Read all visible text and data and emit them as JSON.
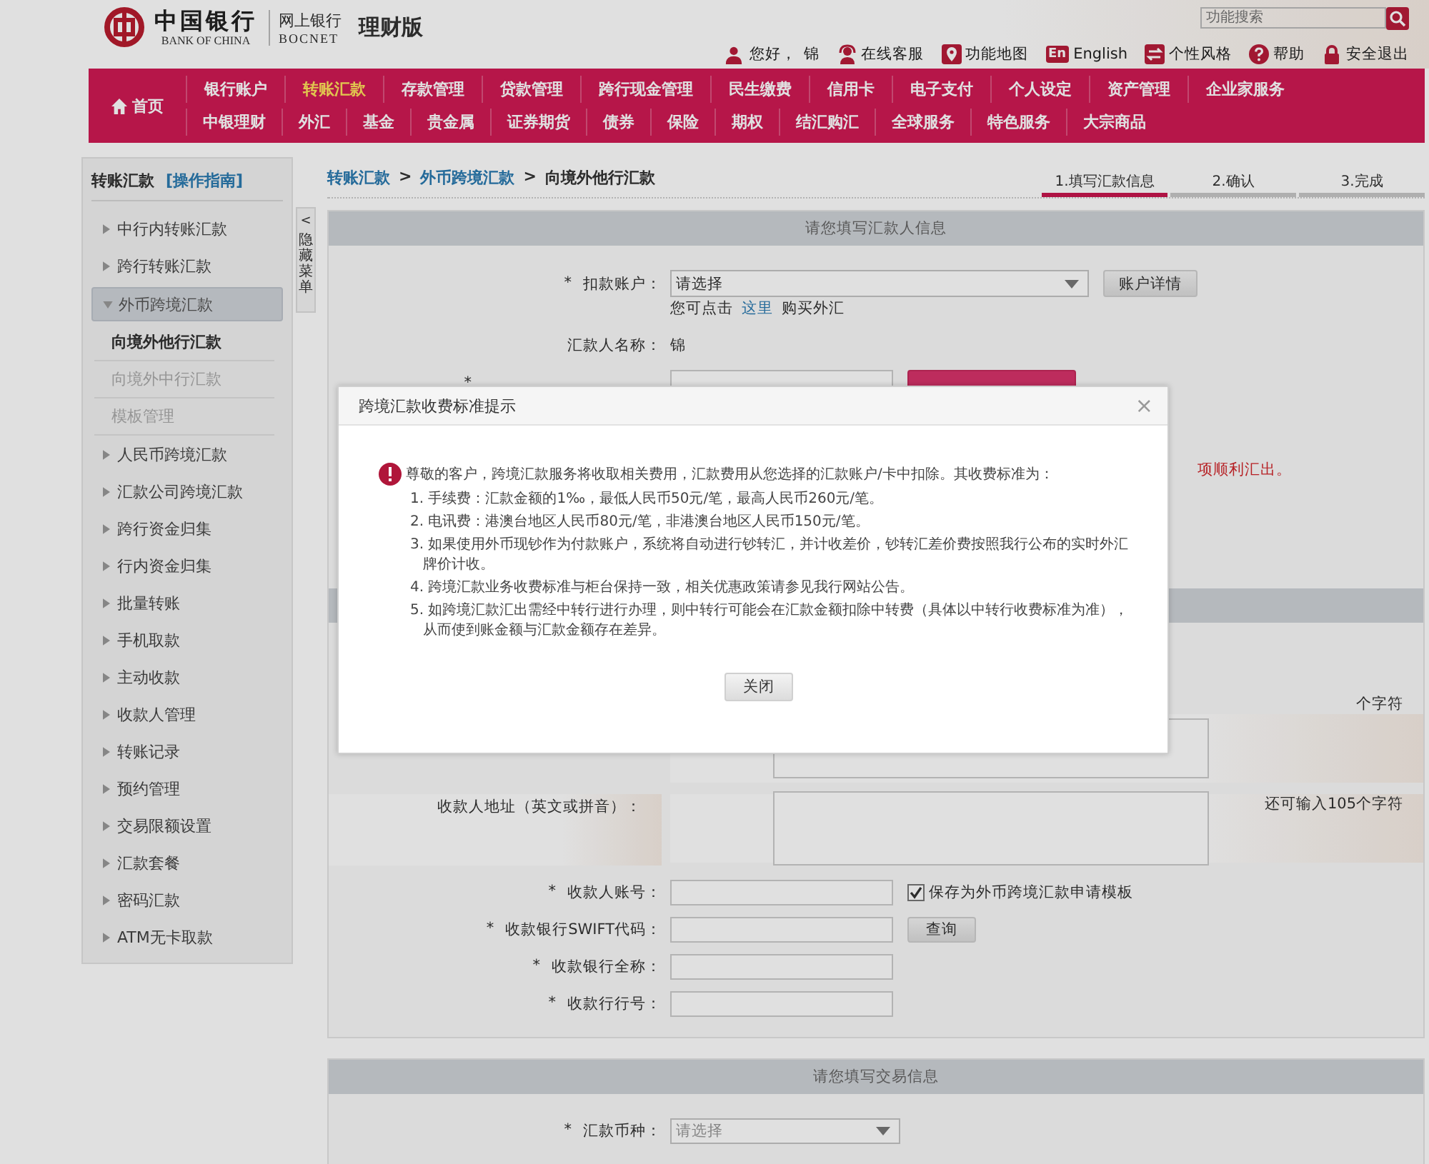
{
  "header": {
    "logo": {
      "name_cn": "中国银行",
      "name_en": "BANK OF CHINA"
    },
    "product": "网上银行",
    "product_en": "BOCNET",
    "edition": "理财版",
    "search": {
      "placeholder": "功能搜索"
    },
    "greeting": "您好，",
    "user_name": "锦",
    "links": [
      {
        "kind": "service",
        "label": "在线客服"
      },
      {
        "kind": "map",
        "label": "功能地图"
      },
      {
        "kind": "lang",
        "badge": "En",
        "label": "English"
      },
      {
        "kind": "style",
        "label": "个性风格"
      },
      {
        "kind": "help",
        "label": "帮助"
      },
      {
        "kind": "logout",
        "label": "安全退出"
      }
    ]
  },
  "nav": {
    "home": "首页",
    "primary": [
      {
        "label": "银行账户",
        "selected": false
      },
      {
        "label": "转账汇款",
        "selected": true
      },
      {
        "label": "存款管理",
        "selected": false
      },
      {
        "label": "贷款管理",
        "selected": false
      },
      {
        "label": "跨行现金管理",
        "selected": false
      },
      {
        "label": "民生缴费",
        "selected": false
      },
      {
        "label": "信用卡",
        "selected": false
      },
      {
        "label": "电子支付",
        "selected": false
      },
      {
        "label": "个人设定",
        "selected": false
      },
      {
        "label": "资产管理",
        "selected": false
      },
      {
        "label": "企业家服务",
        "selected": false
      }
    ],
    "secondary": [
      {
        "label": "中银理财",
        "selected": false
      },
      {
        "label": "外汇",
        "selected": false
      },
      {
        "label": "基金",
        "selected": false
      },
      {
        "label": "贵金属",
        "selected": false
      },
      {
        "label": "证券期货",
        "selected": false
      },
      {
        "label": "债券",
        "selected": false
      },
      {
        "label": "保险",
        "selected": false
      },
      {
        "label": "期权",
        "selected": false
      },
      {
        "label": "结汇购汇",
        "selected": false
      },
      {
        "label": "全球服务",
        "selected": false
      },
      {
        "label": "特色服务",
        "selected": false
      },
      {
        "label": "大宗商品",
        "selected": false
      }
    ]
  },
  "sidebar": {
    "title": "转账汇款",
    "guide": "[操作指南]",
    "items": [
      {
        "label": "中行内转账汇款",
        "expanded": false
      },
      {
        "label": "跨行转账汇款",
        "expanded": false
      },
      {
        "label": "外币跨境汇款",
        "expanded": true,
        "children": [
          {
            "label": "向境外他行汇款",
            "selected": true
          },
          {
            "label": "向境外中行汇款",
            "selected": false
          },
          {
            "label": "模板管理",
            "selected": false
          }
        ]
      },
      {
        "label": "人民币跨境汇款",
        "expanded": false
      },
      {
        "label": "汇款公司跨境汇款",
        "expanded": false
      },
      {
        "label": "跨行资金归集",
        "expanded": false
      },
      {
        "label": "行内资金归集",
        "expanded": false
      },
      {
        "label": "批量转账",
        "expanded": false
      },
      {
        "label": "手机取款",
        "expanded": false
      },
      {
        "label": "主动收款",
        "expanded": false
      },
      {
        "label": "收款人管理",
        "expanded": false
      },
      {
        "label": "转账记录",
        "expanded": false
      },
      {
        "label": "预约管理",
        "expanded": false
      },
      {
        "label": "交易限额设置",
        "expanded": false
      },
      {
        "label": "汇款套餐",
        "expanded": false
      },
      {
        "label": "密码汇款",
        "expanded": false
      },
      {
        "label": "ATM无卡取款",
        "expanded": false
      }
    ]
  },
  "collapse_tab": {
    "arrow": "<",
    "label": "隐藏菜单"
  },
  "breadcrumb": {
    "separator": ">",
    "items": [
      "转账汇款",
      "外币跨境汇款",
      "向境外他行汇款"
    ]
  },
  "steps": [
    {
      "label": "1.填写汇款信息",
      "selected": true
    },
    {
      "label": "2.确认",
      "selected": false
    },
    {
      "label": "3.完成",
      "selected": false
    }
  ],
  "remitter_section": {
    "title": "请您填写汇款人信息",
    "account": {
      "label": "扣款账户：",
      "value": "请选择",
      "button": "账户详情"
    },
    "hint": {
      "text": "您可点击",
      "link": "这里",
      "tail": "购买外汇"
    },
    "name": {
      "label": "汇款人名称：",
      "value": "锦"
    },
    "notice": "项顺利汇出。"
  },
  "payee_section": {
    "name_counter": "个字符",
    "address": {
      "label": "收款人地址（英文或拼音）：",
      "counter": "还可输入105个字符"
    },
    "account": {
      "label": "收款人账号：",
      "save_template": {
        "label": "保存为外币跨境汇款申请模板",
        "checked": true
      }
    },
    "swift": {
      "label": "收款银行SWIFT代码：",
      "button": "查询"
    },
    "bank_name": {
      "label": "收款银行全称："
    },
    "bank_no": {
      "label": "收款行行号："
    }
  },
  "trade_section": {
    "title": "请您填写交易信息",
    "currency": {
      "label": "汇款币种：",
      "placeholder": "请选择"
    }
  },
  "required_mark": "*",
  "dialog": {
    "title": "跨境汇款收费标准提示",
    "close": "×",
    "intro": "尊敬的客户，跨境汇款服务将收取相关费用，汇款费用从您选择的汇款账户/卡中扣除。其收费标准为：",
    "items": [
      "1. 手续费：汇款金额的1‰，最低人民币50元/笔，最高人民币260元/笔。",
      "2. 电讯费：港澳台地区人民币80元/笔，非港澳台地区人民币150元/笔。",
      "3. 如果使用外币现钞作为付款账户，系统将自动进行钞转汇，并计收差价，钞转汇差价费按照我行公布的实时外汇牌价计收。",
      "4. 跨境汇款业务收费标准与柜台保持一致，相关优惠政策请参见我行网站公告。",
      "5. 如跨境汇款汇出需经中转行进行办理，则中转行可能会在汇款金额扣除中转费（具体以中转行收费标准为准），从而使到账金额与汇款金额存在差异。"
    ],
    "button": "关闭"
  }
}
